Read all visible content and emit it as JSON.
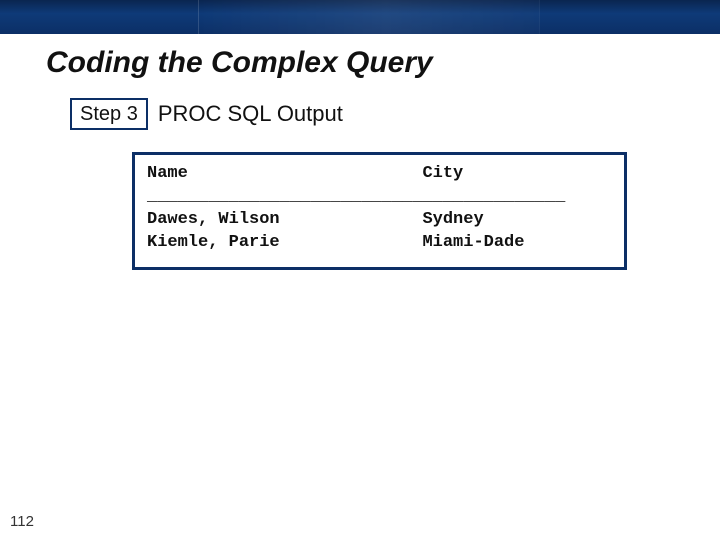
{
  "slide": {
    "title": "Coding the Complex Query",
    "step_badge": "Step 3",
    "step_label": "PROC SQL Output",
    "page_number": "112"
  },
  "output": {
    "headers": [
      "Name",
      "City"
    ],
    "rows": [
      {
        "name": "Dawes, Wilson",
        "city": "Sydney"
      },
      {
        "name": "Kiemle, Parie",
        "city": "Miami-Dade"
      }
    ]
  },
  "chart_data": {
    "type": "table",
    "columns": [
      "Name",
      "City"
    ],
    "rows": [
      [
        "Dawes, Wilson",
        "Sydney"
      ],
      [
        "Kiemle, Parie",
        "Miami-Dade"
      ]
    ]
  }
}
